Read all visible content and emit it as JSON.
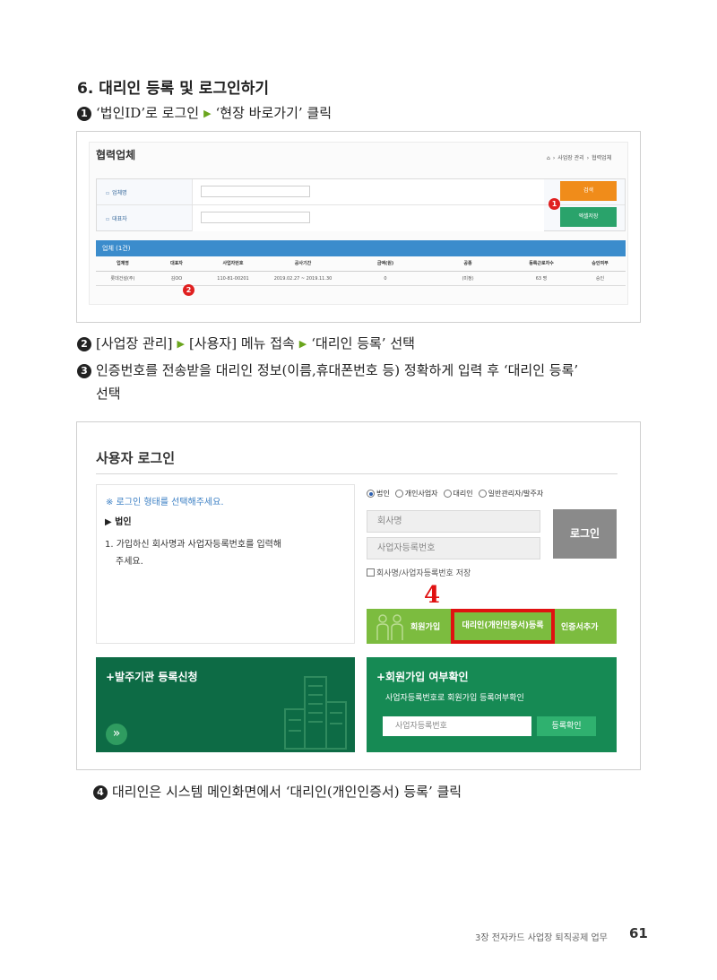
{
  "section_title": "6. 대리인 등록 및 로그인하기",
  "steps": [
    {
      "num": "1",
      "parts": [
        "‘법인ID’로 로그인",
        "‘현장 바로가기’ 클릭"
      ]
    },
    {
      "num": "2",
      "parts": [
        "[사업장 관리]",
        "[사용자] 메뉴 접속",
        "‘대리인 등록’ 선택"
      ]
    },
    {
      "num": "3",
      "line1": "인증번호를 전송받을 대리인 정보(이름,휴대폰번호 등) 정확하게 입력 후 ‘대리인 등록’",
      "line2": "선택"
    },
    {
      "num": "4",
      "text": "대리인은 시스템 메인화면에서 ‘대리인(개인인증서) 등록’ 클릭"
    }
  ],
  "screenshot1": {
    "title": "협력업체",
    "breadcrumb": [
      "사업장 관리",
      "협력업체"
    ],
    "fields": [
      {
        "label": "업체명"
      },
      {
        "label": "대표자"
      }
    ],
    "search_button": "검색",
    "excel_button": "엑셀저장",
    "marker1": "1",
    "marker2": "2",
    "result_bar": "업체 (1건)",
    "columns": [
      "업체명",
      "대표자",
      "사업자번호",
      "공사기간",
      "금액(원)",
      "공종",
      "등록근로자수",
      "승인여부"
    ],
    "row": [
      "롯데건설(주)",
      "김OO",
      "110-81-00201",
      "2019.02.27 ~ 2019.11.30",
      "0",
      "(미정)",
      "63 명",
      "승인"
    ]
  },
  "screenshot2": {
    "title": "사용자 로그인",
    "hint": "※ 로그인 형태를 선택해주세요.",
    "subhead": "▶ 법인",
    "desc_line1": "1. 가입하신 회사명과 사업자등록번호를 입력해",
    "desc_line2": "주세요.",
    "radios": [
      "법인",
      "개인사업자",
      "대리인",
      "일반관리자/발주자"
    ],
    "company_placeholder": "회사명",
    "bizno_placeholder": "사업자등록번호",
    "login_button": "로그인",
    "save_label": "회사명/사업자등록번호 저장",
    "join_label": "회원가입",
    "agent_label": "대리인(개인인증서)등록",
    "cert_label": "인증서추가",
    "marker4": "4",
    "org_title": "+발주기관 등록신청",
    "arrow": "»",
    "check_title": "+회원가입 여부확인",
    "check_desc": "사업자등록번호로 회원가입 등록여부확인",
    "check_placeholder": "사업자등록번호",
    "check_button": "등록확인"
  },
  "footer": {
    "chapter": "3장 전자카드 사업장 퇴직공제 업무",
    "page": "61"
  },
  "colors": {
    "accent_green": "#6aa51d",
    "marker_red": "#e01111",
    "dark_green": "#0d6b45",
    "orange": "#f08c1a"
  }
}
